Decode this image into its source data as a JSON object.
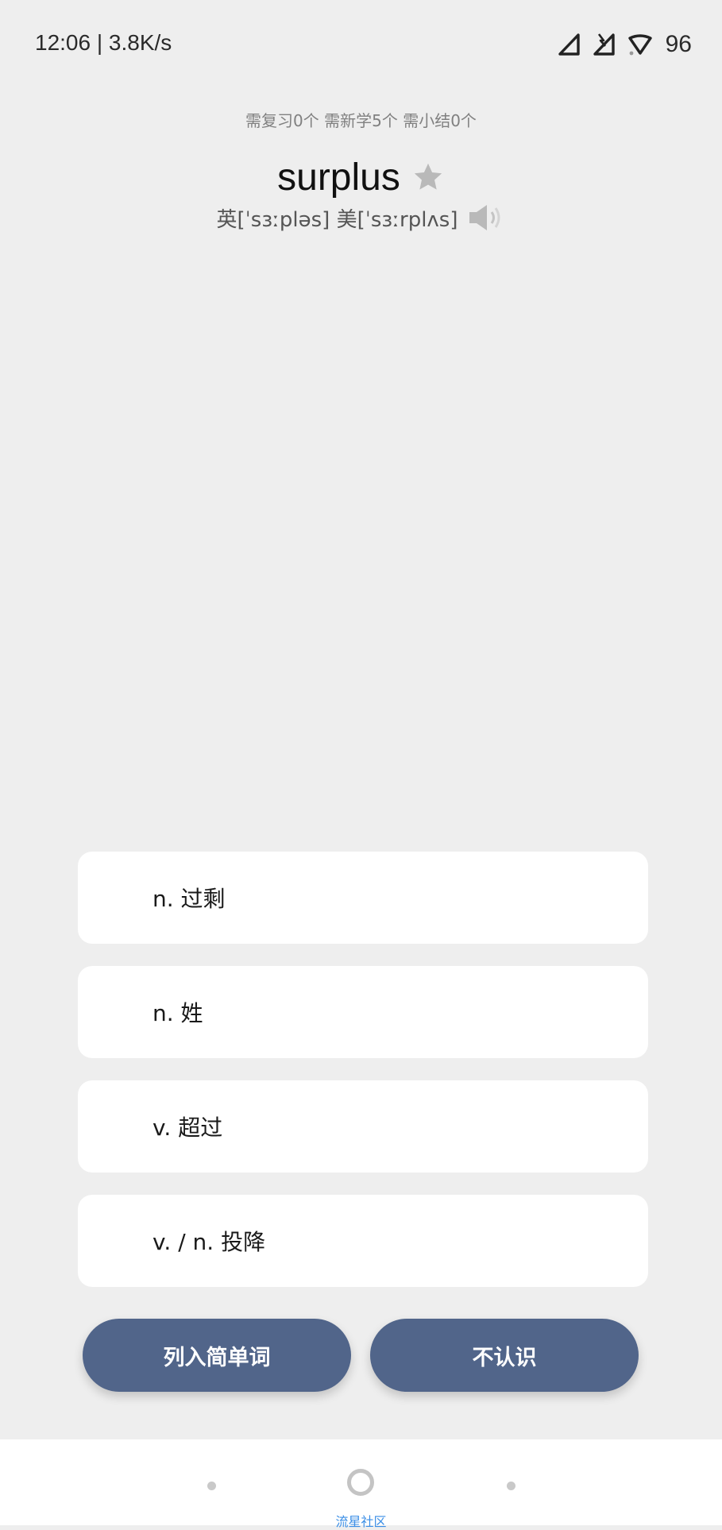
{
  "status_bar": {
    "time_speed": "12:06 | 3.8K/s",
    "battery": "96",
    "icons": [
      "signal-icon",
      "signal-alt-icon",
      "wifi-icon"
    ]
  },
  "progress": {
    "summary": "需复习0个 需新学5个 需小结0个"
  },
  "word": {
    "text": "surplus",
    "phonetic": "英[ˈsɜːpləs] 美[ˈsɜːrplʌs]",
    "star_icon": "star-icon",
    "speaker_icon": "speaker-icon"
  },
  "options": [
    {
      "label": "n. 过剩"
    },
    {
      "label": "n. 姓"
    },
    {
      "label": "v. 超过"
    },
    {
      "label": "v. / n. 投降"
    }
  ],
  "actions": {
    "easy_label": "列入简单词",
    "unknown_label": "不认识"
  },
  "bottom_nav": {
    "label": "流星社区"
  },
  "colors": {
    "background": "#eeeeee",
    "button": "#51658a",
    "nav_label": "#3a8ee6"
  }
}
